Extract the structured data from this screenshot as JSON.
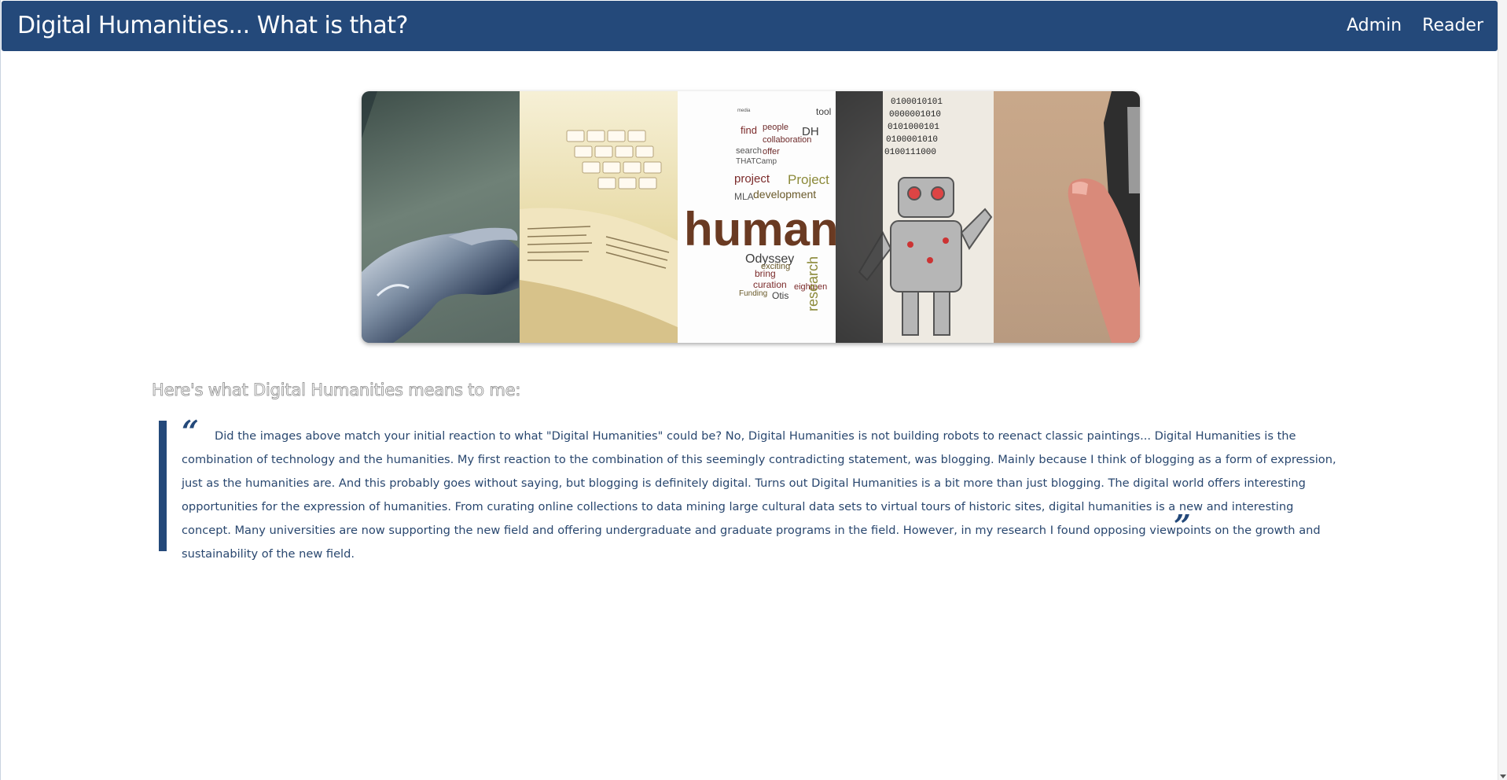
{
  "header": {
    "title": "Digital Humanities... What is that?",
    "nav": [
      {
        "label": "Admin"
      },
      {
        "label": "Reader"
      }
    ],
    "color": "#24497a"
  },
  "banner": {
    "panels": [
      {
        "name": "robot-hand-image"
      },
      {
        "name": "open-book-keyboard-image"
      },
      {
        "name": "humanities-word-cloud-image"
      },
      {
        "name": "robot-binary-book-image"
      },
      {
        "name": "finger-tablet-image"
      }
    ],
    "word_cloud": {
      "words": [
        "media",
        "find",
        "DH",
        "people",
        "collaboration",
        "tool",
        "search",
        "offer",
        "THATCamp",
        "project",
        "Project",
        "MLA",
        "development",
        "humani",
        "Odyssey",
        "bring",
        "exciting",
        "curation",
        "eighteen",
        "Otis",
        "Funding",
        "research"
      ]
    },
    "binary": [
      "0100010101",
      "0000001010",
      "0101000101",
      "0100001010",
      "0100111000"
    ]
  },
  "content": {
    "heading": "Here's what Digital Humanities means to me:",
    "quote_open": "“",
    "quote_close": "”",
    "quote": "Did the images above match your initial reaction to what \"Digital Humanities\" could be? No, Digital Humanities is not building robots to reenact classic paintings... Digital Humanities is the combination of technology and the humanities. My first reaction to the combination of this seemingly contradicting statement, was blogging. Mainly because I think of blogging as a form of expression, just as the humanities are. And this probably goes without saying, but blogging is definitely digital. Turns out Digital Humanities is a bit more than just blogging. The digital world offers interesting opportunities for the expression of humanities. From curating online collections to data mining large cultural data sets to virtual tours of historic sites, digital humanities is a new and interesting concept. Many universities are now supporting the new field and offering undergraduate and graduate programs in the field. However, in my research I found opposing viewpoints on the growth and sustainability of the new field."
  }
}
